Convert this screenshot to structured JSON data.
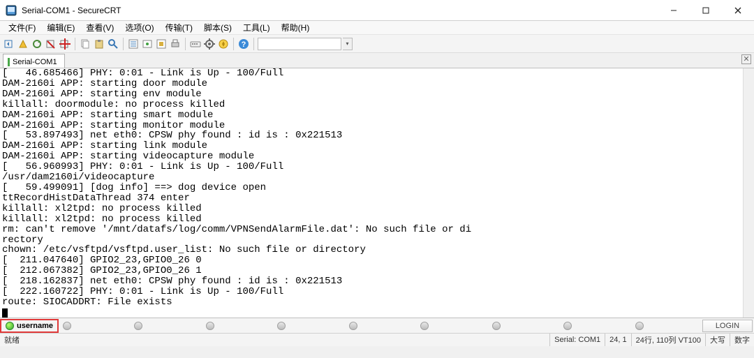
{
  "titlebar": {
    "title": "Serial-COM1 - SecureCRT"
  },
  "menubar": {
    "items": [
      "文件(F)",
      "编辑(E)",
      "查看(V)",
      "选项(O)",
      "传输(T)",
      "脚本(S)",
      "工具(L)",
      "帮助(H)"
    ]
  },
  "toolbar": {
    "host_input": ""
  },
  "tabs": {
    "active": "Serial-COM1"
  },
  "terminal": {
    "lines": [
      "[   46.685466] PHY: 0:01 - Link is Up - 100/Full",
      "DAM-2160i APP: starting door module",
      "DAM-2160i APP: starting env module",
      "killall: doormodule: no process killed",
      "DAM-2160i APP: starting smart module",
      "DAM-2160i APP: starting monitor module",
      "[   53.897493] net eth0: CPSW phy found : id is : 0x221513",
      "DAM-2160i APP: starting link module",
      "DAM-2160i APP: starting videocapture module",
      "[   56.960993] PHY: 0:01 - Link is Up - 100/Full",
      "/usr/dam2160i/videocapture",
      "[   59.499091] [dog info] ==> dog device open",
      "ttRecordHistDataThread 374 enter",
      "killall: xl2tpd: no process killed",
      "killall: xl2tpd: no process killed",
      "rm: can't remove '/mnt/datafs/log/comm/VPNSendAlarmFile.dat': No such file or di",
      "rectory",
      "chown: /etc/vsftpd/vsftpd.user_list: No such file or directory",
      "[  211.047640] GPIO2_23,GPIO0_26 0",
      "[  212.067382] GPIO2_23,GPIO0_26 1",
      "[  218.162837] net eth0: CPSW phy found : id is : 0x221513",
      "[  222.160722] PHY: 0:01 - Link is Up - 100/Full",
      "route: SIOCADDRT: File exists"
    ]
  },
  "buttonbar": {
    "username": "username",
    "login": "LOGIN"
  },
  "statusbar": {
    "ready": "就绪",
    "conn": "Serial: COM1",
    "pos": "24,   1",
    "size": "24行, 110列  VT100",
    "caps": "大写",
    "num": "数字"
  }
}
